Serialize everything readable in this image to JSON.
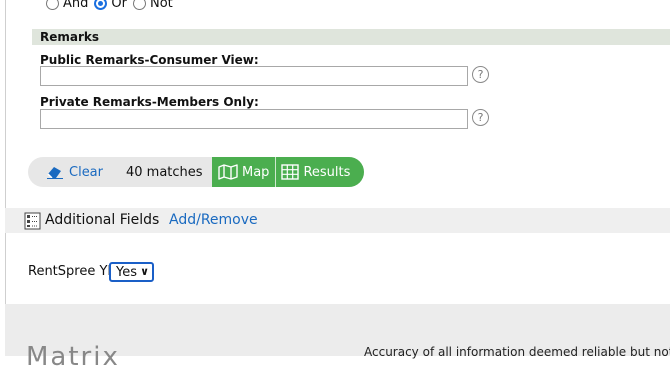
{
  "logic": {
    "options": [
      "And",
      "Or",
      "Not"
    ],
    "selected": "Or"
  },
  "remarks": {
    "header": "Remarks",
    "public_label": "Public Remarks-Consumer View:",
    "public_value": "",
    "private_label": "Private Remarks-Members Only:",
    "private_value": "",
    "help": "?"
  },
  "toolbar": {
    "clear_label": "Clear",
    "matches": "40 matches",
    "map_label": "Map",
    "results_label": "Results",
    "accent": "#4bae4f"
  },
  "additional_fields": {
    "title": "Additional Fields",
    "link": "Add/Remove"
  },
  "rentspree": {
    "label": "RentSpree YN",
    "selected": "Yes"
  },
  "footer": {
    "title": "Matrix",
    "disclaimer": "Accuracy of all information deemed reliable but not"
  }
}
